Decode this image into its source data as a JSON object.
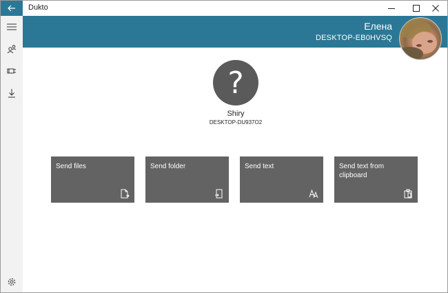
{
  "window": {
    "title": "Dukto"
  },
  "user": {
    "name": "Елена",
    "host": "DESKTOP-EB0HVSQ"
  },
  "peer": {
    "avatar_glyph": "?",
    "name": "Shiry",
    "host": "DESKTOP-DU937O2"
  },
  "actions": [
    {
      "label": "Send files",
      "icon": "send-file-icon"
    },
    {
      "label": "Send folder",
      "icon": "send-folder-icon"
    },
    {
      "label": "Send text",
      "icon": "text-icon"
    },
    {
      "label": "Send text from clipboard",
      "icon": "clipboard-icon"
    }
  ],
  "sidebar": {
    "items": [
      {
        "icon": "hamburger-menu-icon"
      },
      {
        "icon": "buddies-icon"
      },
      {
        "icon": "ip-address-icon"
      },
      {
        "icon": "download-icon"
      },
      {
        "icon": "settings-gear-icon"
      }
    ]
  },
  "colors": {
    "accent": "#2b7896",
    "tile": "#636363",
    "sidebar": "#f2f2f2",
    "peer_avatar": "#5a5a5a"
  }
}
